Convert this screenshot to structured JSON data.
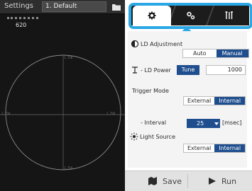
{
  "viewer": {
    "settings_label": "Settings",
    "settings_value": "1. Default",
    "reading": "620",
    "scale_top": "1.750",
    "scale_left": "1.750",
    "scale_right": "1.750",
    "scale_bottom": "1.750"
  },
  "tabs": [
    {
      "name": "general",
      "icon": "gear-icon",
      "active": true
    },
    {
      "name": "hardware",
      "icon": "gears-icon",
      "active": false
    },
    {
      "name": "tools",
      "icon": "tools-icon",
      "active": false
    }
  ],
  "ld_adjustment": {
    "label": "LD Adjustment",
    "options": [
      "Auto",
      "Manual"
    ],
    "selected": "Manual"
  },
  "ld_power": {
    "label": "- LD Power",
    "tune_label": "Tune",
    "value": "1000"
  },
  "trigger_mode": {
    "label": "Trigger Mode",
    "options": [
      "External",
      "Internal"
    ],
    "selected": "Internal",
    "interval_label": "- Interval",
    "interval_value": "25",
    "interval_unit": "[msec]"
  },
  "light_source": {
    "label": "Light Source",
    "options": [
      "External",
      "Internal"
    ],
    "selected": "Internal"
  },
  "footer": {
    "save_label": "Save",
    "run_label": "Run"
  },
  "colors": {
    "accent": "#1f4e8e",
    "highlight": "#2aa7e4",
    "viewer_bg": "#151515"
  }
}
